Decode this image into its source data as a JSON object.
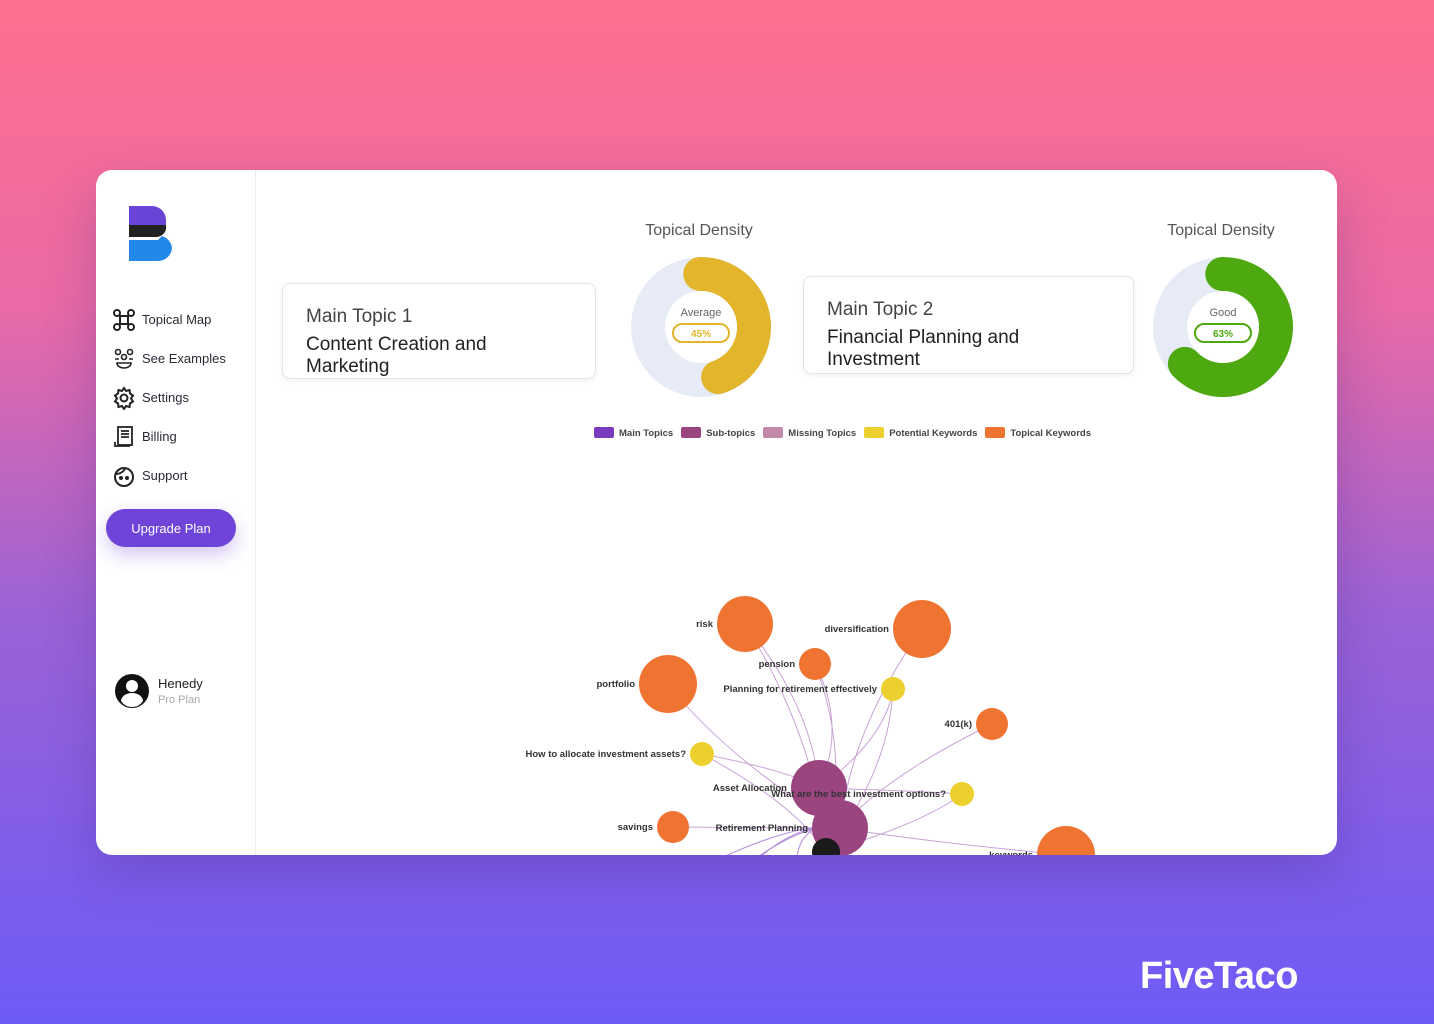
{
  "sidebar": {
    "items": [
      {
        "label": "Topical Map",
        "icon": "topical-map-icon"
      },
      {
        "label": "See Examples",
        "icon": "examples-icon"
      },
      {
        "label": "Settings",
        "icon": "gear-icon"
      },
      {
        "label": "Billing",
        "icon": "billing-icon"
      },
      {
        "label": "Support",
        "icon": "support-icon"
      }
    ],
    "upgrade_label": "Upgrade Plan",
    "user": {
      "name": "Henedy",
      "plan": "Pro Plan"
    }
  },
  "topics": [
    {
      "title": "Main Topic 1",
      "name": "Content Creation and Marketing",
      "density_title": "Topical Density",
      "density_label": "Average",
      "density_value": "45%",
      "density_percent": 45,
      "color": "#e2b52c"
    },
    {
      "title": "Main Topic 2",
      "name": "Financial Planning and Investment",
      "density_title": "Topical Density",
      "density_label": "Good",
      "density_value": "63%",
      "density_percent": 63,
      "color": "#4ea80f"
    }
  ],
  "legend": [
    {
      "label": "Main Topics",
      "color": "#7b3bbf"
    },
    {
      "label": "Sub-topics",
      "color": "#9a4580"
    },
    {
      "label": "Missing Topics",
      "color": "#c28aa8"
    },
    {
      "label": "Potential Keywords",
      "color": "#ecd02f"
    },
    {
      "label": "Topical Keywords",
      "color": "#ef7431"
    }
  ],
  "graph": {
    "nodes": [
      {
        "label": "risk",
        "type": "Topical Keywords"
      },
      {
        "label": "diversification",
        "type": "Topical Keywords"
      },
      {
        "label": "pension",
        "type": "Topical Keywords"
      },
      {
        "label": "portfolio",
        "type": "Topical Keywords"
      },
      {
        "label": "Planning for retirement effectively",
        "type": "Potential Keywords"
      },
      {
        "label": "401(k)",
        "type": "Topical Keywords"
      },
      {
        "label": "How to allocate investment assets?",
        "type": "Potential Keywords"
      },
      {
        "label": "Asset Allocation",
        "type": "Sub-topics"
      },
      {
        "label": "What are the best investment options?",
        "type": "Potential Keywords"
      },
      {
        "label": "savings",
        "type": "Topical Keywords"
      },
      {
        "label": "Retirement Planning",
        "type": "Sub-topics"
      },
      {
        "label": "keywords",
        "type": "Topical Keywords"
      }
    ]
  },
  "brand": "FiveTaco"
}
